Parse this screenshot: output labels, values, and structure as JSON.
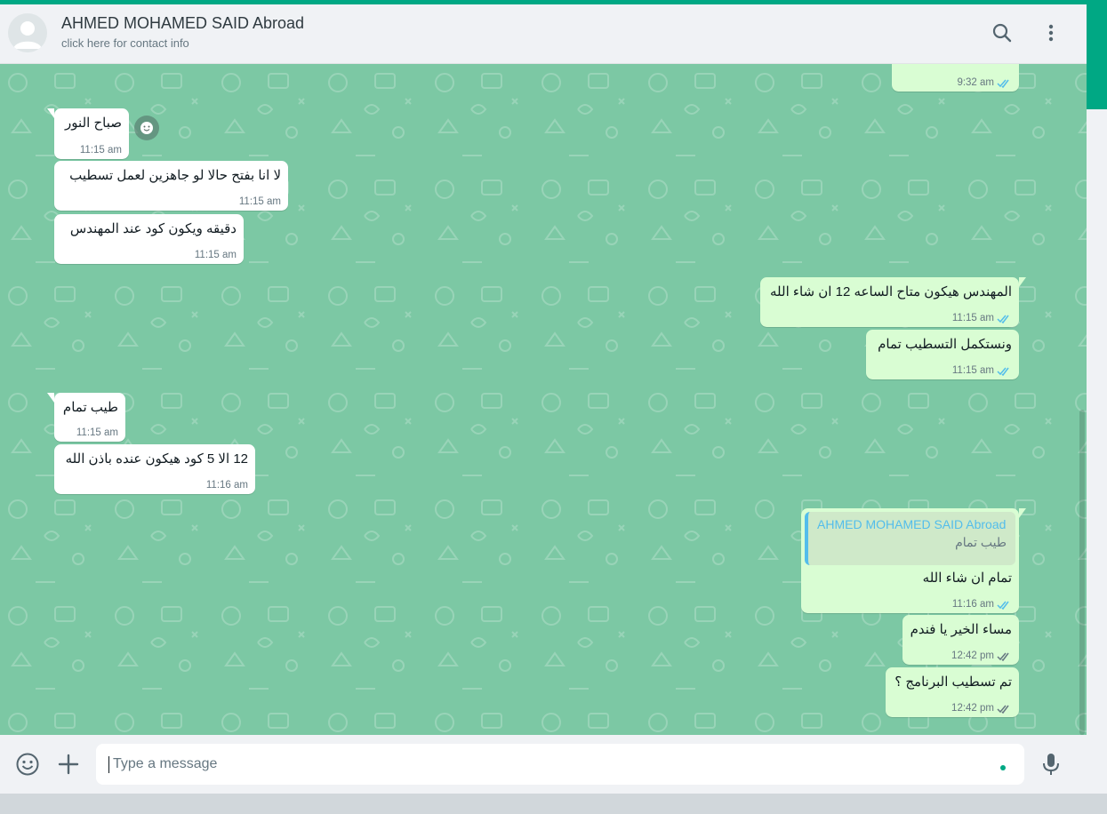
{
  "header": {
    "contact_name": "AHMED MOHAMED SAID Abroad",
    "subtitle": "click here for contact info",
    "avatar_icon": "default-avatar-icon",
    "search_icon": "search-icon",
    "menu_icon": "more-vertical-icon"
  },
  "messages": [
    {
      "direction": "out",
      "text": "",
      "time": "9:32 am",
      "status": "read"
    },
    {
      "direction": "in",
      "text": "صباح النور",
      "time": "11:15 am",
      "reaction_icon": "emoji-reaction-icon"
    },
    {
      "direction": "in",
      "text": "لا انا بفتح حالا لو جاهزين لعمل تسطيب",
      "time": "11:15 am"
    },
    {
      "direction": "in",
      "text": "دقيقه ويكون كود عند المهندس",
      "time": "11:15 am"
    },
    {
      "direction": "out",
      "text": "المهندس هيكون متاح الساعه 12 ان شاء الله",
      "time": "11:15 am",
      "status": "read"
    },
    {
      "direction": "out",
      "text": "ونستكمل التسطيب تمام",
      "time": "11:15 am",
      "status": "read"
    },
    {
      "direction": "in",
      "text": "طيب تمام",
      "time": "11:15 am"
    },
    {
      "direction": "in",
      "text": "12 الا 5 كود هيكون عنده باذن الله",
      "time": "11:16 am"
    },
    {
      "direction": "out",
      "quote_name": "AHMED MOHAMED SAID Abroad",
      "quote_text": "طيب تمام",
      "text": "تمام ان شاء الله",
      "time": "11:16 am",
      "status": "read"
    },
    {
      "direction": "out",
      "text": "مساء الخير يا فندم",
      "time": "12:42 pm",
      "status": "delivered"
    },
    {
      "direction": "out",
      "text": "تم تسطيب البرنامج ؟",
      "time": "12:42 pm",
      "status": "delivered"
    }
  ],
  "composer": {
    "placeholder": "Type a message",
    "emoji_icon": "emoji-icon",
    "attach_icon": "plus-icon",
    "mic_icon": "microphone-icon"
  },
  "colors": {
    "accent": "#00a884",
    "chat_background": "#7cc8a4",
    "incoming_bubble": "#ffffff",
    "outgoing_bubble": "#d9fdd3",
    "read_tick": "#53bdeb",
    "delivered_tick": "#667781"
  }
}
